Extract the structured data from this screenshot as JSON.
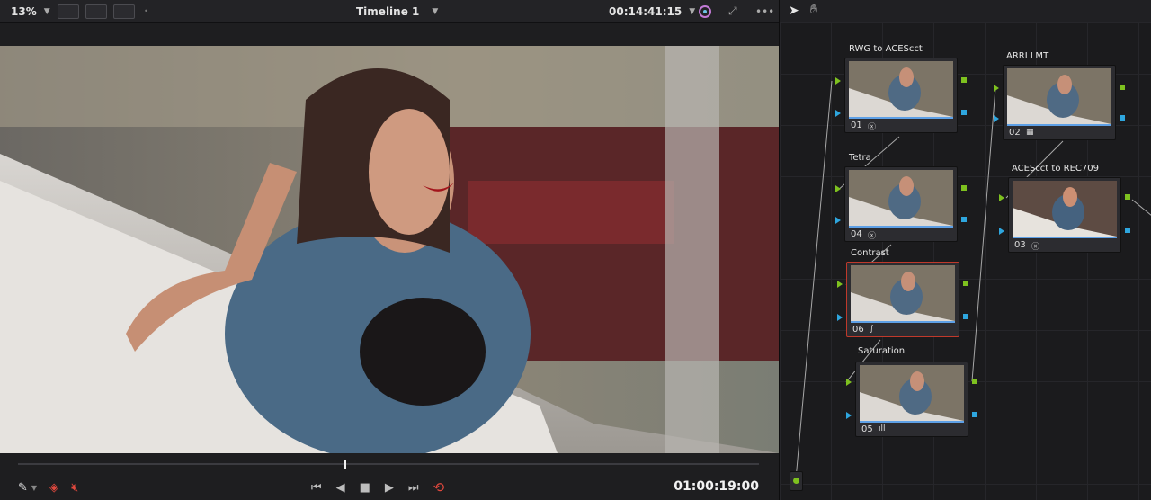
{
  "viewer": {
    "zoom": "13%",
    "timeline_name": "Timeline 1",
    "source_timecode": "00:14:41:15",
    "record_timecode": "01:00:19:00",
    "playhead_progress": 0.44
  },
  "nodes": [
    {
      "label": "RWG to ACEScct",
      "number": "01",
      "icon": "ⓧ"
    },
    {
      "label": "ARRI LMT",
      "number": "02",
      "icon": "▦"
    },
    {
      "label": "ACEScct to REC709",
      "number": "03",
      "icon": "ⓧ"
    },
    {
      "label": "Tetra",
      "number": "04",
      "icon": "ⓧ"
    },
    {
      "label": "Contrast",
      "number": "06",
      "icon": "∫"
    },
    {
      "label": "Saturation",
      "number": "05",
      "icon": "ıll"
    }
  ],
  "colors": {
    "accent_green": "#7ec11f",
    "accent_blue": "#2ea6de",
    "selected_red": "#c0392b",
    "loop_red": "#e0483d"
  }
}
